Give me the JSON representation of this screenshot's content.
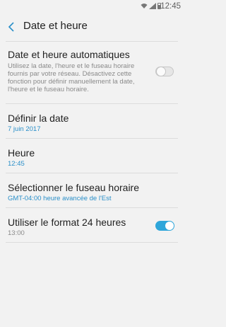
{
  "status": {
    "time": "12:45",
    "icons": [
      "wifi-icon",
      "signal-icon",
      "battery-icon"
    ]
  },
  "header": {
    "title": "Date et heure",
    "back_icon": "chevron-left-icon"
  },
  "items": [
    {
      "label": "Date et heure automatiques",
      "sub": "Utilisez la date, l'heure et le fuseau horaire fournis par votre réseau. Désactivez cette fonction pour définir manuellement la date, l'heure et le fuseau horaire.",
      "toggle": false
    },
    {
      "label": "Définir la date",
      "sub": "7 juin 2017"
    },
    {
      "label": "Heure",
      "sub": "12:45"
    },
    {
      "label": "Sélectionner le fuseau horaire",
      "sub": "GMT-04:00 heure avancée de l'Est"
    },
    {
      "label": "Utiliser le format 24 heures",
      "sub": "13:00",
      "toggle": true
    }
  ],
  "colors": {
    "accent": "#2fa6da",
    "subtitle_blue": "#2a8fc9",
    "background": "#f2f2f2"
  }
}
